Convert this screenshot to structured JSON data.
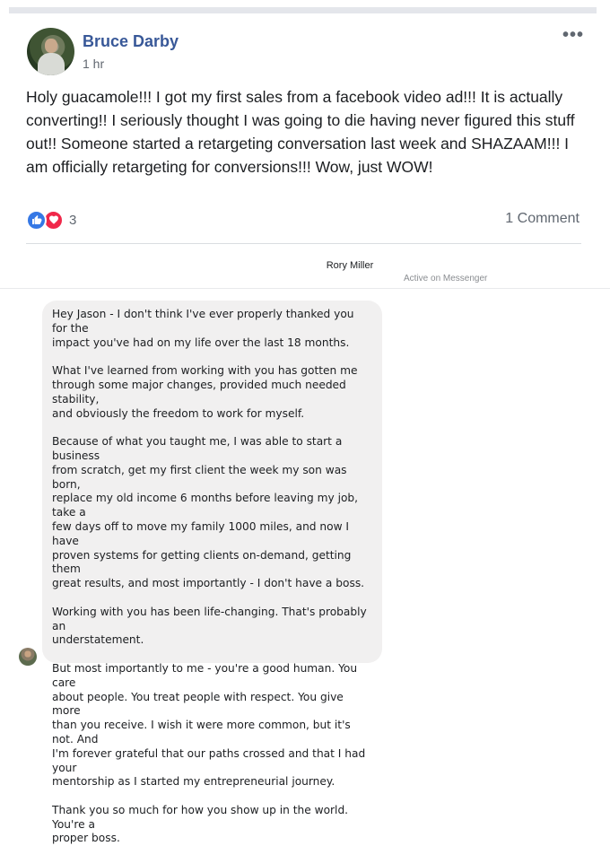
{
  "post": {
    "author": "Bruce Darby",
    "time": "1 hr",
    "more": "•••",
    "text": "Holy guacamole!!! I got my first sales from a facebook video ad!!! It is actually converting!! I seriously thought I was going to die having never figured this stuff out!! Someone started a retargeting conversation last week and SHAZAAM!!! I am officially retargeting for conversions!!! Wow, just WOW!",
    "reaction_count": "3",
    "comments": "1 Comment",
    "reaction_icons": [
      "like-icon",
      "love-icon"
    ],
    "colors": {
      "name": "#385898",
      "like": "#3578e5",
      "love": "#f0284a"
    }
  },
  "messenger": {
    "contact_name": "Rory Miller",
    "contact_status": "Active on Messenger",
    "message_paragraphs": [
      "Hey Jason - I don't think I've ever properly thanked you for the\nimpact you've had on my life over the last 18 months.",
      "What I've learned from working with you has gotten me\nthrough some major changes, provided much needed stability,\nand obviously the freedom to work for myself.",
      "Because of what you taught me, I was able to start a business\nfrom scratch, get my first client the week my son was born,\nreplace my old income 6 months before leaving my job, take a\nfew days off to move my family 1000 miles, and now I have\nproven systems for getting clients on-demand, getting them\ngreat results, and most importantly - I don't have a boss.",
      "Working with you has been life-changing. That's probably an\nunderstatement.",
      "But most importantly to me - you're a good human. You care\nabout people. You treat people with respect. You give more\nthan you receive. I wish it were more common, but it's not. And\nI'm forever grateful that our paths crossed and that I had your\nmentorship as I started my entrepreneurial journey.",
      "Thank you so much for how you show up in the world. You're a\nproper boss."
    ],
    "colors": {
      "bubble": "#f1f0f0"
    }
  }
}
